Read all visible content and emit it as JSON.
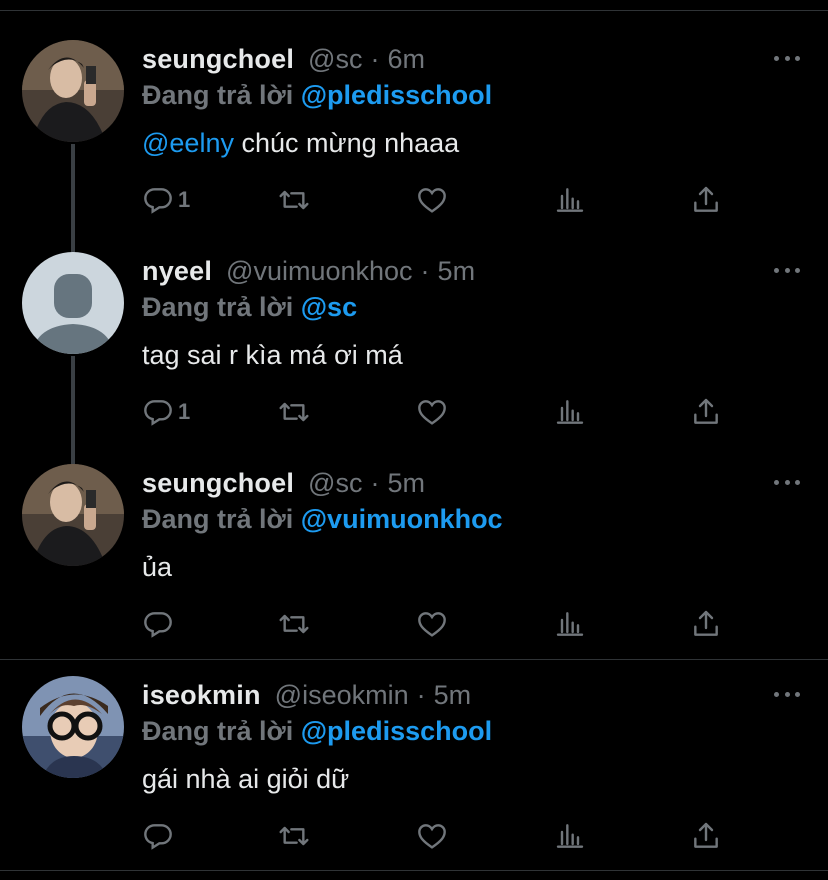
{
  "icons": {
    "reply": "reply-icon",
    "retweet": "retweet-icon",
    "like": "heart-icon",
    "views": "views-icon",
    "share": "share-icon",
    "more": "more-icon"
  },
  "colors": {
    "background": "#000000",
    "text": "#e7e9ea",
    "muted": "#71767b",
    "accent": "#1d9bf0",
    "divider": "#2f3336"
  },
  "reply_prefix": "Đang trả lời",
  "tweets": [
    {
      "name": "seungchoel",
      "handle": "@sc",
      "separator": "·",
      "time": "6m",
      "replying_to": "@pledisschool",
      "mention": "@eelny",
      "text": " chúc mừng nhaaa",
      "reply_count": "1"
    },
    {
      "name": "nyeel",
      "handle": "@vuimuonkhoc",
      "separator": "·",
      "time": "5m",
      "replying_to": "@sc",
      "mention": "",
      "text": "tag sai r kìa má ơi má",
      "reply_count": "1"
    },
    {
      "name": "seungchoel",
      "handle": "@sc",
      "separator": "·",
      "time": "5m",
      "replying_to": "@vuimuonkhoc",
      "mention": "",
      "text": "ủa",
      "reply_count": ""
    },
    {
      "name": "iseokmin",
      "handle": "@iseokmin",
      "separator": "·",
      "time": "5m",
      "replying_to": "@pledisschool",
      "mention": "",
      "text": "gái nhà ai giỏi dữ",
      "reply_count": ""
    }
  ]
}
